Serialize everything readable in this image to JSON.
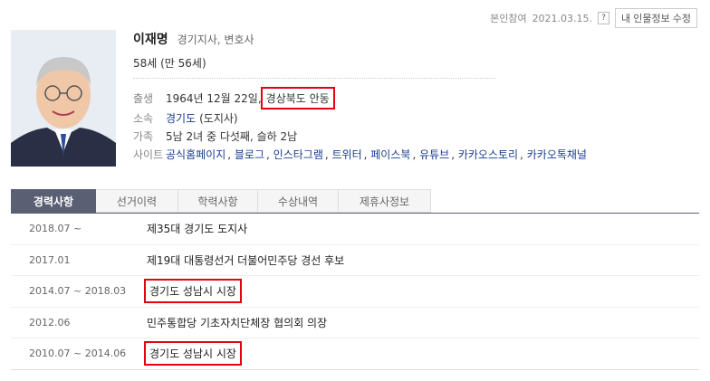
{
  "topbar": {
    "verify_text": "본인참여",
    "date": "2021.03.15.",
    "help_symbol": "?",
    "edit_button": "내 인물정보 수정"
  },
  "profile": {
    "name": "이재명",
    "job": "경기지사, 변호사",
    "age": "58세 (만 56세)",
    "birth": {
      "label": "출생",
      "date": "1964년 12월 22일,",
      "place": "경상북도 안동"
    },
    "affiliation": {
      "label": "소속",
      "region": "경기도",
      "role": "(도지사)"
    },
    "family": {
      "label": "가족",
      "value": "5남 2녀 중 다섯째, 슬하 2남"
    },
    "sites": {
      "label": "사이트",
      "links": [
        "공식홈페이지",
        "블로그",
        "인스타그램",
        "트위터",
        "페이스북",
        "유튜브",
        "카카오스토리",
        "카카오톡채널"
      ]
    }
  },
  "tabs": [
    {
      "label": "경력사항",
      "active": true
    },
    {
      "label": "선거이력",
      "active": false
    },
    {
      "label": "학력사항",
      "active": false
    },
    {
      "label": "수상내역",
      "active": false
    },
    {
      "label": "제휴사정보",
      "active": false
    }
  ],
  "career": [
    {
      "date": "2018.07 ~",
      "title": "제35대 경기도 도지사",
      "highlight": false
    },
    {
      "date": "2017.01",
      "title": "제19대 대통령선거 더불어민주당 경선 후보",
      "highlight": false
    },
    {
      "date": "2014.07 ~ 2018.03",
      "title": "경기도 성남시 시장",
      "highlight": true
    },
    {
      "date": "2012.06",
      "title": "민주통합당 기초자치단체장 협의회 의장",
      "highlight": false
    },
    {
      "date": "2010.07 ~ 2014.06",
      "title": "경기도 성남시 시장",
      "highlight": true
    }
  ],
  "colors": {
    "link": "#1a3d8f",
    "highlight": "#e60012",
    "active_tab": "#5a5f73"
  }
}
